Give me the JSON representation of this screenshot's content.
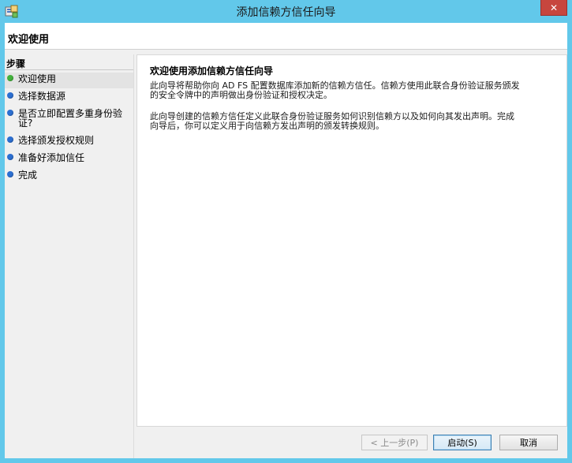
{
  "window": {
    "title": "添加信赖方信任向导",
    "close_label": "✕"
  },
  "header": {
    "title": "欢迎使用"
  },
  "steps": {
    "title": "步骤",
    "items": [
      {
        "label": "欢迎使用",
        "state": "current",
        "color": "#43b23c"
      },
      {
        "label": "选择数据源",
        "state": "pending",
        "color": "#2c6fd1"
      },
      {
        "label_line1": "是否立即配置多重身份验",
        "label_line2": "证?",
        "state": "pending",
        "color": "#2c6fd1"
      },
      {
        "label": "选择颁发授权规则",
        "state": "pending",
        "color": "#2c6fd1"
      },
      {
        "label": "准备好添加信任",
        "state": "pending",
        "color": "#2c6fd1"
      },
      {
        "label": "完成",
        "state": "pending",
        "color": "#2c6fd1"
      }
    ]
  },
  "content": {
    "title": "欢迎使用添加信赖方信任向导",
    "para1_line1": "此向导将帮助你向 AD FS 配置数据库添加新的信赖方信任。信赖方使用此联合身份验证服务颁发",
    "para1_line2": "的安全令牌中的声明做出身份验证和授权决定。",
    "para2_line1": "此向导创建的信赖方信任定义此联合身份验证服务如何识别信赖方以及如何向其发出声明。完成",
    "para2_line2": "向导后，你可以定义用于向信赖方发出声明的颁发转换规则。"
  },
  "buttons": {
    "back": "< 上一步(P)",
    "start": "启动(S)",
    "cancel": "取消"
  }
}
